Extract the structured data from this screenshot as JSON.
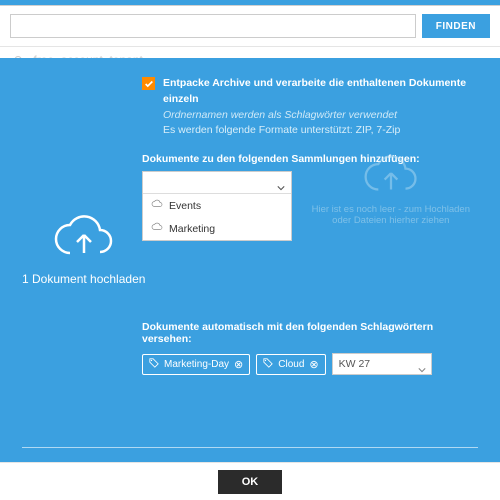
{
  "search": {
    "placeholder": "",
    "button": "FINDEN"
  },
  "ghost": {
    "tenant": "free_account_tenant"
  },
  "checkbox": {
    "line1": "Entpacke Archive und verarbeite die enthaltenen Dokumente einzeln",
    "line2": "Ordnernamen werden als Schlagwörter verwendet",
    "line3": "Es werden folgende Formate unterstützt: ZIP, 7-Zip"
  },
  "collections": {
    "label": "Dokumente zu den folgenden Sammlungen hinzufügen:",
    "items": [
      "Events",
      "Marketing"
    ]
  },
  "upload": {
    "caption": "1 Dokument hochladen"
  },
  "dropzone": {
    "l1": "Hier ist es noch leer - zum Hochladen",
    "l2": "oder Dateien hierher ziehen"
  },
  "tags": {
    "label": "Dokumente automatisch mit den folgenden Schlagwörtern versehen:",
    "items": [
      "Marketing-Day",
      "Cloud"
    ],
    "input": "KW 27"
  },
  "footer": {
    "ok": "OK"
  }
}
